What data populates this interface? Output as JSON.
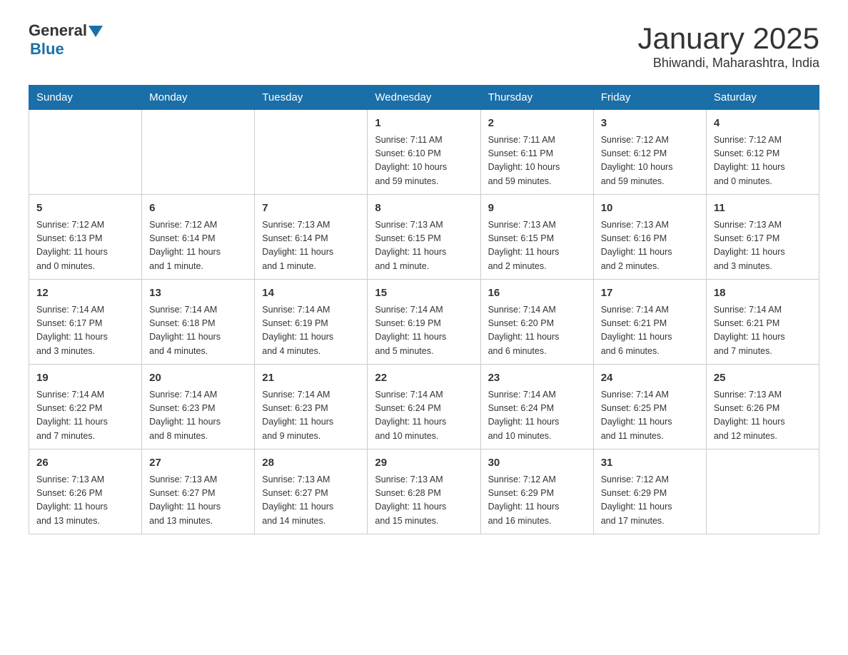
{
  "header": {
    "logo": {
      "general": "General",
      "triangle": "▶",
      "blue": "Blue"
    },
    "title": "January 2025",
    "location": "Bhiwandi, Maharashtra, India"
  },
  "weekdays": [
    "Sunday",
    "Monday",
    "Tuesday",
    "Wednesday",
    "Thursday",
    "Friday",
    "Saturday"
  ],
  "weeks": [
    [
      {
        "day": "",
        "info": ""
      },
      {
        "day": "",
        "info": ""
      },
      {
        "day": "",
        "info": ""
      },
      {
        "day": "1",
        "info": "Sunrise: 7:11 AM\nSunset: 6:10 PM\nDaylight: 10 hours\nand 59 minutes."
      },
      {
        "day": "2",
        "info": "Sunrise: 7:11 AM\nSunset: 6:11 PM\nDaylight: 10 hours\nand 59 minutes."
      },
      {
        "day": "3",
        "info": "Sunrise: 7:12 AM\nSunset: 6:12 PM\nDaylight: 10 hours\nand 59 minutes."
      },
      {
        "day": "4",
        "info": "Sunrise: 7:12 AM\nSunset: 6:12 PM\nDaylight: 11 hours\nand 0 minutes."
      }
    ],
    [
      {
        "day": "5",
        "info": "Sunrise: 7:12 AM\nSunset: 6:13 PM\nDaylight: 11 hours\nand 0 minutes."
      },
      {
        "day": "6",
        "info": "Sunrise: 7:12 AM\nSunset: 6:14 PM\nDaylight: 11 hours\nand 1 minute."
      },
      {
        "day": "7",
        "info": "Sunrise: 7:13 AM\nSunset: 6:14 PM\nDaylight: 11 hours\nand 1 minute."
      },
      {
        "day": "8",
        "info": "Sunrise: 7:13 AM\nSunset: 6:15 PM\nDaylight: 11 hours\nand 1 minute."
      },
      {
        "day": "9",
        "info": "Sunrise: 7:13 AM\nSunset: 6:15 PM\nDaylight: 11 hours\nand 2 minutes."
      },
      {
        "day": "10",
        "info": "Sunrise: 7:13 AM\nSunset: 6:16 PM\nDaylight: 11 hours\nand 2 minutes."
      },
      {
        "day": "11",
        "info": "Sunrise: 7:13 AM\nSunset: 6:17 PM\nDaylight: 11 hours\nand 3 minutes."
      }
    ],
    [
      {
        "day": "12",
        "info": "Sunrise: 7:14 AM\nSunset: 6:17 PM\nDaylight: 11 hours\nand 3 minutes."
      },
      {
        "day": "13",
        "info": "Sunrise: 7:14 AM\nSunset: 6:18 PM\nDaylight: 11 hours\nand 4 minutes."
      },
      {
        "day": "14",
        "info": "Sunrise: 7:14 AM\nSunset: 6:19 PM\nDaylight: 11 hours\nand 4 minutes."
      },
      {
        "day": "15",
        "info": "Sunrise: 7:14 AM\nSunset: 6:19 PM\nDaylight: 11 hours\nand 5 minutes."
      },
      {
        "day": "16",
        "info": "Sunrise: 7:14 AM\nSunset: 6:20 PM\nDaylight: 11 hours\nand 6 minutes."
      },
      {
        "day": "17",
        "info": "Sunrise: 7:14 AM\nSunset: 6:21 PM\nDaylight: 11 hours\nand 6 minutes."
      },
      {
        "day": "18",
        "info": "Sunrise: 7:14 AM\nSunset: 6:21 PM\nDaylight: 11 hours\nand 7 minutes."
      }
    ],
    [
      {
        "day": "19",
        "info": "Sunrise: 7:14 AM\nSunset: 6:22 PM\nDaylight: 11 hours\nand 7 minutes."
      },
      {
        "day": "20",
        "info": "Sunrise: 7:14 AM\nSunset: 6:23 PM\nDaylight: 11 hours\nand 8 minutes."
      },
      {
        "day": "21",
        "info": "Sunrise: 7:14 AM\nSunset: 6:23 PM\nDaylight: 11 hours\nand 9 minutes."
      },
      {
        "day": "22",
        "info": "Sunrise: 7:14 AM\nSunset: 6:24 PM\nDaylight: 11 hours\nand 10 minutes."
      },
      {
        "day": "23",
        "info": "Sunrise: 7:14 AM\nSunset: 6:24 PM\nDaylight: 11 hours\nand 10 minutes."
      },
      {
        "day": "24",
        "info": "Sunrise: 7:14 AM\nSunset: 6:25 PM\nDaylight: 11 hours\nand 11 minutes."
      },
      {
        "day": "25",
        "info": "Sunrise: 7:13 AM\nSunset: 6:26 PM\nDaylight: 11 hours\nand 12 minutes."
      }
    ],
    [
      {
        "day": "26",
        "info": "Sunrise: 7:13 AM\nSunset: 6:26 PM\nDaylight: 11 hours\nand 13 minutes."
      },
      {
        "day": "27",
        "info": "Sunrise: 7:13 AM\nSunset: 6:27 PM\nDaylight: 11 hours\nand 13 minutes."
      },
      {
        "day": "28",
        "info": "Sunrise: 7:13 AM\nSunset: 6:27 PM\nDaylight: 11 hours\nand 14 minutes."
      },
      {
        "day": "29",
        "info": "Sunrise: 7:13 AM\nSunset: 6:28 PM\nDaylight: 11 hours\nand 15 minutes."
      },
      {
        "day": "30",
        "info": "Sunrise: 7:12 AM\nSunset: 6:29 PM\nDaylight: 11 hours\nand 16 minutes."
      },
      {
        "day": "31",
        "info": "Sunrise: 7:12 AM\nSunset: 6:29 PM\nDaylight: 11 hours\nand 17 minutes."
      },
      {
        "day": "",
        "info": ""
      }
    ]
  ]
}
